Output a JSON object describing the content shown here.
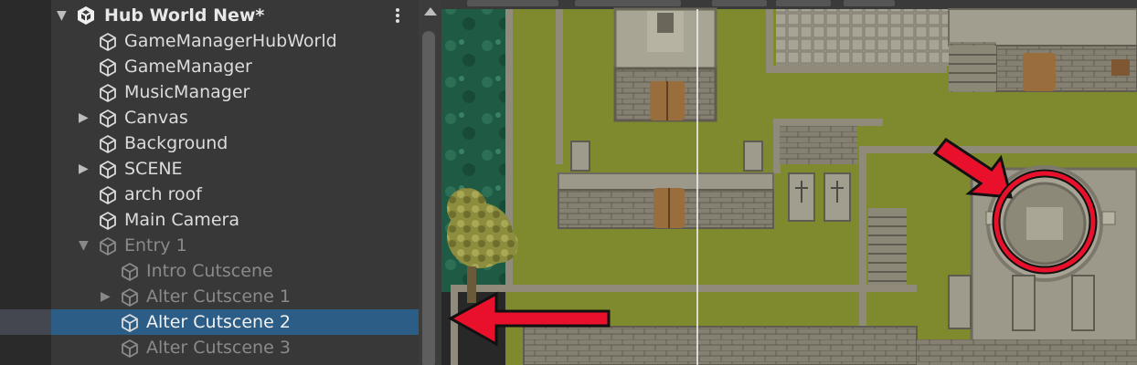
{
  "hierarchy": {
    "scene_title": "Hub World New*",
    "items": [
      {
        "label": "GameManagerHubWorld",
        "expandable": false,
        "dim": false
      },
      {
        "label": "GameManager",
        "expandable": false,
        "dim": false
      },
      {
        "label": "MusicManager",
        "expandable": false,
        "dim": false
      },
      {
        "label": "Canvas",
        "expandable": true,
        "dim": false
      },
      {
        "label": "Background",
        "expandable": false,
        "dim": false
      },
      {
        "label": "SCENE",
        "expandable": true,
        "dim": false
      },
      {
        "label": "arch roof",
        "expandable": false,
        "dim": false
      },
      {
        "label": "Main Camera",
        "expandable": false,
        "dim": false
      },
      {
        "label": "Entry 1",
        "expandable": true,
        "expanded": true,
        "dim": true
      },
      {
        "label": "Intro Cutscene",
        "expandable": false,
        "dim": true
      },
      {
        "label": "Alter Cutscene 1",
        "expandable": true,
        "dim": true
      },
      {
        "label": "Alter Cutscene 2",
        "expandable": false,
        "dim": true,
        "selected": true
      },
      {
        "label": "Alter Cutscene 3",
        "expandable": false,
        "dim": true
      }
    ]
  },
  "colors": {
    "panel_bg": "#383838",
    "selection": "#2c5d87",
    "grass": "#7f8a2e",
    "stone": "#8a8576",
    "annotation_red": "#e8102a"
  },
  "icons": [
    "unity-logo-icon",
    "gameobject-cube-icon",
    "foldout-arrow-icon",
    "kebab-menu-icon",
    "scroll-up-icon"
  ]
}
